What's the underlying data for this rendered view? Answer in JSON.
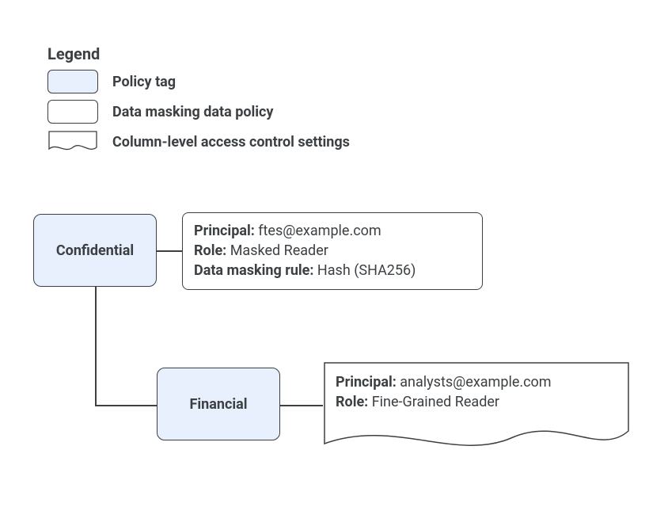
{
  "legend": {
    "title": "Legend",
    "items": [
      {
        "label": "Policy tag"
      },
      {
        "label": "Data masking data policy"
      },
      {
        "label": "Column-level access control settings"
      }
    ]
  },
  "nodes": {
    "confidential": {
      "label": "Confidential"
    },
    "financial": {
      "label": "Financial"
    },
    "masking_policy": {
      "principal_k": "Principal:",
      "principal_v": " ftes@example.com",
      "role_k": "Role:",
      "role_v": " Masked Reader",
      "rule_k": "Data masking rule:",
      "rule_v": " Hash (SHA256)"
    },
    "clac": {
      "principal_k": "Principal:",
      "principal_v": " analysts@example.com",
      "role_k": "Role:",
      "role_v": " Fine-Grained Reader"
    }
  }
}
